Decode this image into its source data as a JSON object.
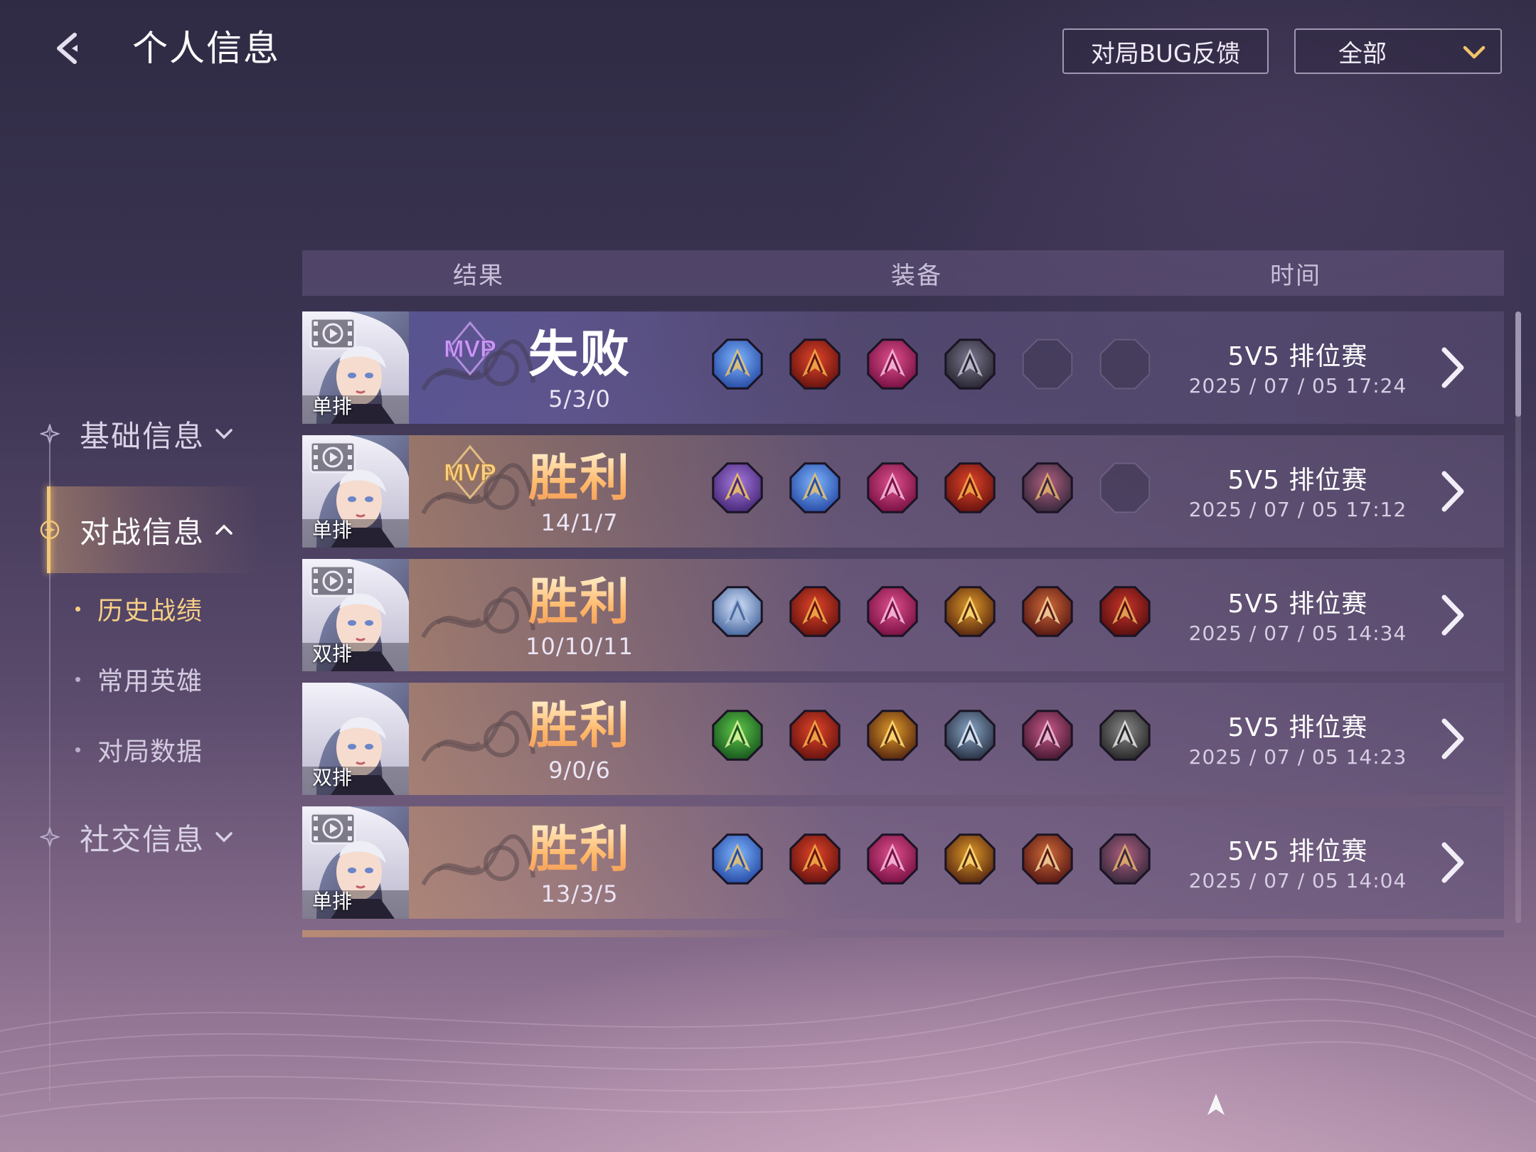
{
  "header": {
    "title": "个人信息",
    "bug_feedback_label": "对局BUG反馈",
    "filter": {
      "selected": "全部"
    }
  },
  "nav": {
    "groups": [
      {
        "label": "基础信息",
        "expanded": false
      },
      {
        "label": "对战信息",
        "expanded": true,
        "items": [
          {
            "label": "历史战绩",
            "active": true
          },
          {
            "label": "常用英雄",
            "active": false
          },
          {
            "label": "对局数据",
            "active": false
          }
        ]
      },
      {
        "label": "社交信息",
        "expanded": false
      }
    ]
  },
  "table": {
    "headers": {
      "result": "结果",
      "items": "装备",
      "time": "时间"
    },
    "rows": [
      {
        "queue": "单排",
        "mvp": true,
        "result": "失败",
        "outcome": "lose",
        "kda": "5/3/0",
        "mode": "5V5 排位赛",
        "time": "2025 / 07 / 05 17:24",
        "items": [
          "blue-wing-boots-icon",
          "crimson-axe-icon",
          "pink-spear-icon",
          "dark-scythe-icon",
          "empty-slot-icon",
          "empty-slot-icon"
        ],
        "replay": true
      },
      {
        "queue": "单排",
        "mvp": true,
        "result": "胜利",
        "outcome": "win",
        "kda": "14/1/7",
        "mode": "5V5 排位赛",
        "time": "2025 / 07 / 05 17:12",
        "items": [
          "purple-gold-armor-icon",
          "blue-wing-boots-icon",
          "pink-spear-icon",
          "crimson-axe-icon",
          "dark-bow-icon",
          "empty-slot-icon"
        ],
        "replay": true
      },
      {
        "queue": "双排",
        "mvp": false,
        "result": "胜利",
        "outcome": "win",
        "kda": "10/10/11",
        "mode": "5V5 排位赛",
        "time": "2025 / 07 / 05 14:34",
        "items": [
          "silver-wing-boots-icon",
          "crimson-axe-icon",
          "pink-spear-icon",
          "golden-spear-icon",
          "chain-amulet-icon",
          "red-helm-icon"
        ],
        "replay": true
      },
      {
        "queue": "双排",
        "mvp": false,
        "result": "胜利",
        "outcome": "win",
        "kda": "9/0/6",
        "mode": "5V5 排位赛",
        "time": "2025 / 07 / 05 14:23",
        "items": [
          "green-leaf-icon",
          "crimson-axe-icon",
          "golden-spear-icon",
          "silver-ring-icon",
          "magenta-cross-icon",
          "steel-axe-icon"
        ],
        "replay": false
      },
      {
        "queue": "单排",
        "mvp": false,
        "result": "胜利",
        "outcome": "win",
        "kda": "13/3/5",
        "mode": "5V5 排位赛",
        "time": "2025 / 07 / 05 14:04",
        "items": [
          "blue-wing-boots-icon",
          "crimson-axe-icon",
          "pink-spear-icon",
          "golden-spear-icon",
          "chain-amulet-icon",
          "dark-bow-icon"
        ],
        "replay": true
      }
    ]
  },
  "icons": {
    "back": "back-arrow-icon",
    "dropdown": "chevron-down-icon",
    "row_detail": "chevron-right-icon",
    "replay": "replay-film-icon",
    "mvp": "mvp-badge-icon"
  },
  "colors": {
    "accent_gold": "#f6cf86",
    "win_text": "#ffb86a",
    "lose_text": "#ffffff",
    "background_top": "#2f2b44",
    "background_bottom": "#a98ba6"
  }
}
